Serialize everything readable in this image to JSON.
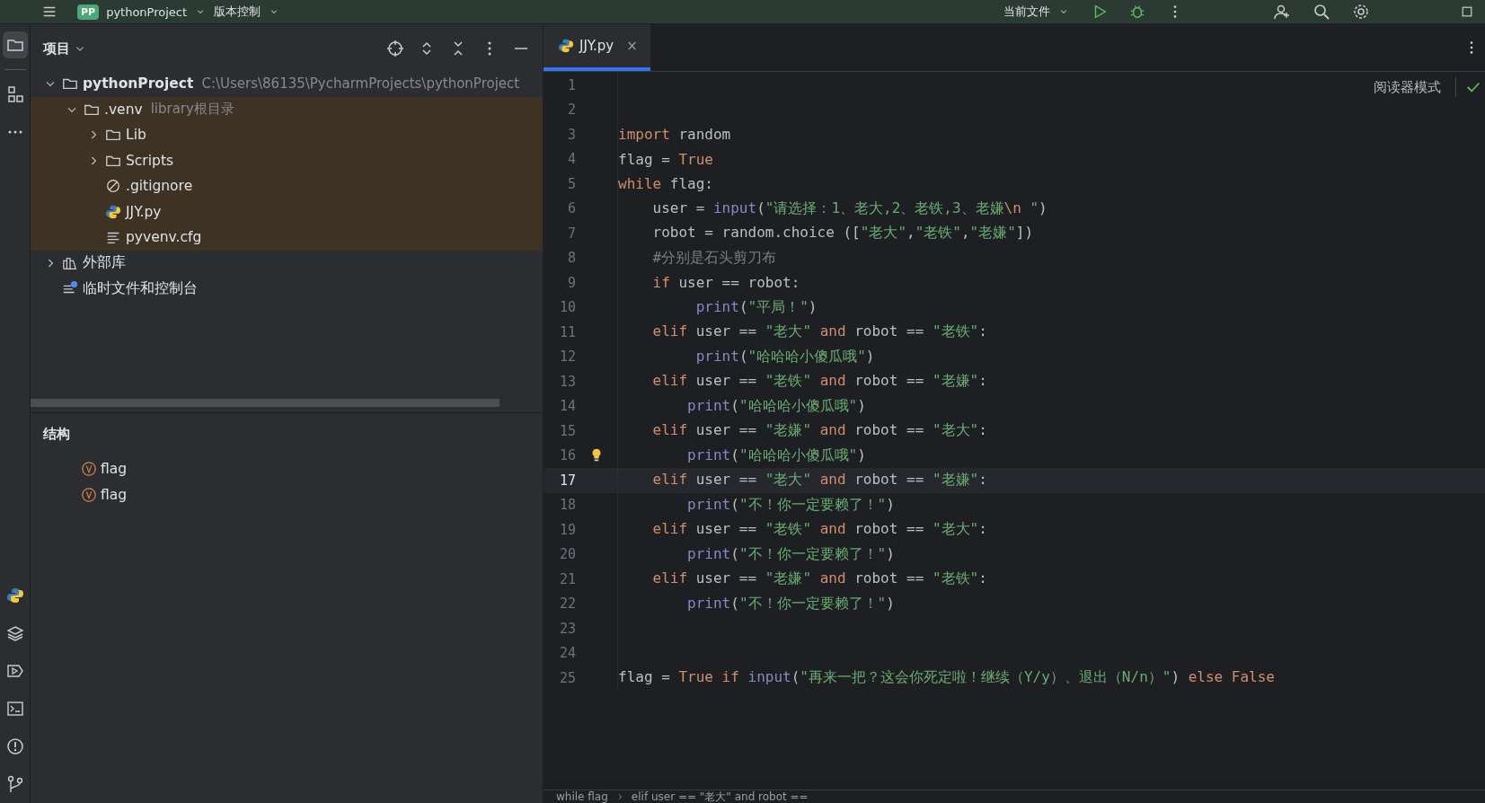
{
  "top_bar": {
    "project_badge": "PP",
    "project": "pythonProject",
    "vcs": "版本控制",
    "run_config": "当前文件"
  },
  "left_toolbar": {
    "top": [
      {
        "kind": "folder",
        "selected": true
      },
      {
        "kind": "structure",
        "selected": false
      },
      {
        "kind": "more",
        "selected": false
      }
    ],
    "bottom": [
      {
        "kind": "python",
        "selected": false
      },
      {
        "kind": "layers",
        "selected": false
      },
      {
        "kind": "run",
        "selected": false
      },
      {
        "kind": "terminal",
        "selected": false
      },
      {
        "kind": "problems",
        "selected": false
      },
      {
        "kind": "git",
        "selected": false
      }
    ]
  },
  "project_panel": {
    "title": "项目",
    "tree": [
      {
        "label": "pythonProject",
        "hint": "C:\\Users\\86135\\PycharmProjects\\pythonProject",
        "kind": "folder",
        "expanded": true,
        "highlighted": false,
        "children": [
          {
            "label": ".venv",
            "hint": "library根目录",
            "kind": "folder",
            "expanded": true,
            "highlighted": true,
            "children": [
              {
                "label": "Lib",
                "kind": "folder",
                "expanded": false,
                "highlighted": true
              },
              {
                "label": "Scripts",
                "kind": "folder",
                "expanded": false,
                "highlighted": true
              },
              {
                "label": ".gitignore",
                "kind": "ignore",
                "highlighted": true
              },
              {
                "label": "JJY.py",
                "kind": "python",
                "highlighted": true
              },
              {
                "label": "pyvenv.cfg",
                "kind": "text",
                "highlighted": true
              }
            ]
          }
        ]
      },
      {
        "label": "外部库",
        "kind": "library",
        "expanded": false,
        "highlighted": false
      },
      {
        "label": "临时文件和控制台",
        "kind": "scratch",
        "highlighted": false
      }
    ]
  },
  "structure_panel": {
    "title": "结构",
    "items": [
      {
        "name": "flag",
        "kind": "variable"
      },
      {
        "name": "flag",
        "kind": "variable"
      }
    ]
  },
  "editor": {
    "tabs": [
      {
        "label": "JJY.py",
        "close": "×",
        "selected": true
      }
    ],
    "reader_mode": "阅读器模式",
    "lines": [
      {
        "number": "1",
        "current": false
      },
      {
        "number": "2",
        "current": false
      },
      {
        "number": "3",
        "current": false,
        "code": "import random"
      },
      {
        "number": "4",
        "current": false,
        "code": "flag = True"
      },
      {
        "number": "5",
        "current": false,
        "code": "while flag:"
      },
      {
        "number": "6",
        "current": false,
        "code": "    user = input(\"请选择：1、老大,2、老铁,3、老嫌\\n \")"
      },
      {
        "number": "7",
        "current": false,
        "code": "    robot = random.choice ([\"老大\",\"老铁\",\"老嫌\"])"
      },
      {
        "number": "8",
        "current": false,
        "code": "    #分别是石头剪刀布"
      },
      {
        "number": "9",
        "current": false,
        "code": "    if user == robot:"
      },
      {
        "number": "10",
        "current": false,
        "code": "         print(\"平局！\")"
      },
      {
        "number": "11",
        "current": false,
        "code": "    elif user == \"老大\" and robot == \"老铁\":"
      },
      {
        "number": "12",
        "current": false,
        "code": "         print(\"哈哈哈小傻瓜哦\")"
      },
      {
        "number": "13",
        "current": false,
        "code": "    elif user == \"老铁\" and robot == \"老嫌\":"
      },
      {
        "number": "14",
        "current": false,
        "code": "        print(\"哈哈哈小傻瓜哦\")"
      },
      {
        "number": "15",
        "current": false,
        "code": "    elif user == \"老嫌\" and robot == \"老大\":"
      },
      {
        "number": "16",
        "current": false,
        "hint": true,
        "code": "        print(\"哈哈哈小傻瓜哦\")"
      },
      {
        "number": "17",
        "current": true,
        "code": "    elif user == \"老大\" and robot == \"老嫌\":"
      },
      {
        "number": "18",
        "current": false,
        "code": "        print(\"不！你一定要赖了！\")"
      },
      {
        "number": "19",
        "current": false,
        "code": "    elif user == \"老铁\" and robot == \"老大\":"
      },
      {
        "number": "20",
        "current": false,
        "code": "        print(\"不！你一定要赖了！\")"
      },
      {
        "number": "21",
        "current": false,
        "code": "    elif user == \"老嫌\" and robot == \"老铁\":"
      },
      {
        "number": "22",
        "current": false,
        "code": "        print(\"不！你一定要赖了！\")"
      },
      {
        "number": "23",
        "current": false
      },
      {
        "number": "24",
        "current": false
      },
      {
        "number": "25",
        "current": false,
        "code": "flag = True if input(\"再来一把？这会你死定啦！继续（Y/y）、退出（N/n）\") else False"
      }
    ],
    "breadcrumbs": [
      "while flag",
      "elif user == \"老大\" and robot =="
    ]
  }
}
